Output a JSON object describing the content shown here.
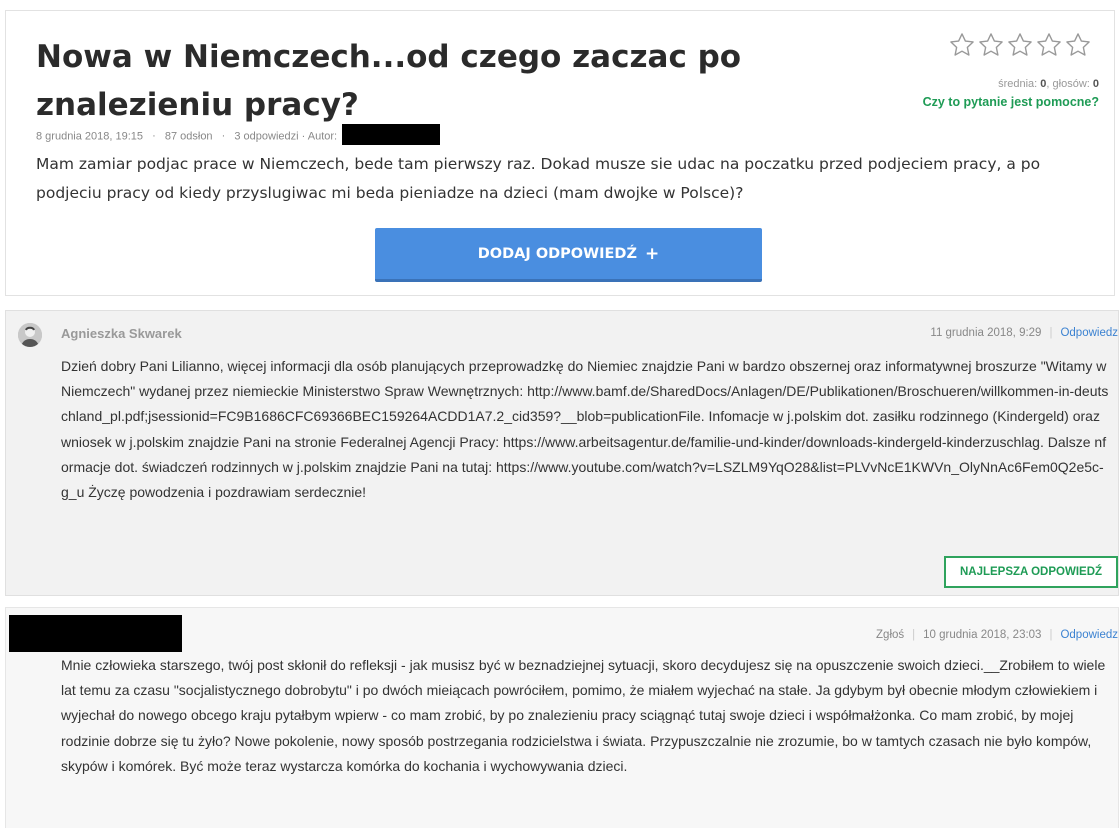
{
  "question": {
    "title": "Nowa w Niemczech...od czego zaczac po znalezieniu pracy?",
    "date": "8 grudnia 2018, 19:15",
    "views": "87 odsłon",
    "answers_count": "3 odpowiedzi",
    "author_label": "· Autor:",
    "body": "Mam zamiar podjac prace w Niemczech, bede tam pierwszy raz. Dokad musze sie udac na poczatku przed podjeciem pracy, a po podjeciu pracy od kiedy przyslugiwac mi beda pieniadze na dzieci (mam dwojke w Polsce)?",
    "answer_button_label": "DODAJ ODPOWIEDŹ",
    "answer_button_icon": "+",
    "rating": {
      "stars_total": 5,
      "stars_filled": 0,
      "avg_label": "średnia:",
      "avg_value": "0",
      "votes_label": "głosów:",
      "votes_value": "0",
      "helpful_label": "Czy to pytanie jest pomocne?"
    }
  },
  "replies": [
    {
      "author": "Agnieszka Skwarek",
      "date": "11 grudnia 2018, 9:29",
      "reply_link": "Odpowiedz",
      "body": "Dzień dobry Pani Lilianno, więcej informacji dla osób planujących przeprowadzkę do Niemiec znajdzie Pani w bardzo obszernej oraz informatywnej broszurze \"Witamy w Niemczech\" wydanej przez niemieckie Ministerstwo Spraw Wewnętrznych: http://www.bamf.de/SharedDocs/Anlagen/DE/Publikationen/Broschueren/willkommen-in-deutschland_pl.pdf;jsessionid=FC9B1686CFC69366BEC159264ACDD1A7.2_cid359?__blob=publicationFile. Infomacje w j.polskim dot. zasiłku rodzinnego (Kindergeld) oraz wniosek w j.polskim znajdzie Pani na stronie Federalnej Agencji Pracy: https://www.arbeitsagentur.de/familie-und-kinder/downloads-kindergeld-kinderzuschlag. Dalsze nformacje dot. świadczeń rodzinnych w j.polskim znajdzie Pani na tutaj: https://www.youtube.com/watch?v=LSZLM9YqO28&list=PLVvNcE1KWVn_OlyNnAc6Fem0Q2e5c-g_u Życzę powodzenia i pozdrawiam serdecznie!",
      "best_answer_label": "NAJLEPSZA ODPOWIEDŹ"
    },
    {
      "report_link": "Zgłoś",
      "date": "10 grudnia 2018, 23:03",
      "reply_link": "Odpowiedz",
      "body": "Mnie człowieka starszego, twój post skłonił do refleksji - jak musisz być w beznadziejnej sytuacji, skoro decydujesz się na opuszczenie swoich dzieci.__Zrobiłem to wiele lat temu za czasu \"socjalistycznego dobrobytu\" i po dwóch mieiącach powróciłem, pomimo, że miałem wyjechać na stałe. Ja gdybym był obecnie młodym człowiekiem i wyjechał do nowego obcego kraju pytałbym wpierw - co mam zrobić, by po znalezieniu pracy sciągnąć tutaj swoje dzieci i współmałżonka. Co mam zrobić, by mojej rodzinie dobrze się tu żyło? Nowe pokolenie, nowy sposób postrzegania rodzicielstwa i świata. Przypuszczalnie nie zrozumie, bo w tamtych czasach nie było kompów, skypów i komórek. Być może teraz wystarcza komórka do kochania i wychowywania dzieci."
    }
  ]
}
